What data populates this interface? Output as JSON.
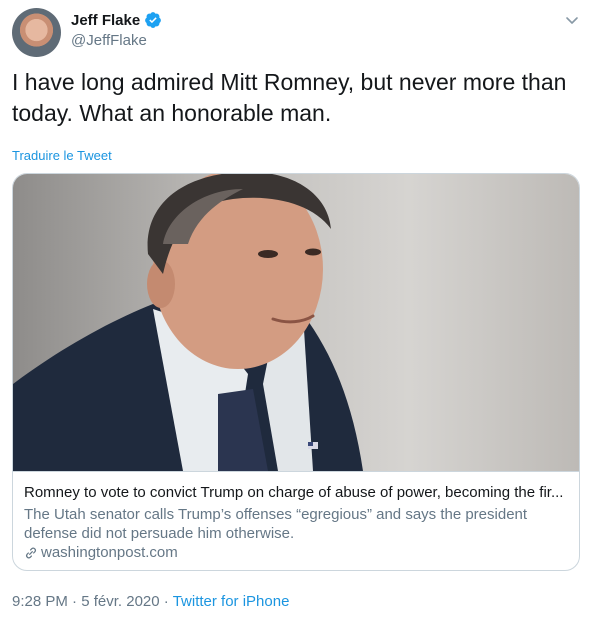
{
  "author": {
    "name": "Jeff Flake",
    "handle": "@JeffFlake"
  },
  "tweet": {
    "text": "I have long admired Mitt Romney, but never more than today. What an honorable man.",
    "translate_label": "Traduire le Tweet"
  },
  "card": {
    "title": "Romney to vote to convict Trump on charge of abuse of power, becoming the fir...",
    "description": "The Utah senator calls Trump’s offenses “egregious” and says the president defense did not persuade him otherwise.",
    "domain": "washingtonpost.com"
  },
  "meta": {
    "time": "9:28 PM",
    "separator": " · ",
    "date": "5 févr. 2020",
    "source": "Twitter for iPhone"
  },
  "colors": {
    "link": "#1b95e0",
    "secondary_text": "#657786",
    "border": "#ccd6dd",
    "verified": "#1da1f2"
  },
  "icons": {
    "verified": "verified-badge-icon",
    "chevron": "chevron-down-icon",
    "link": "link-icon"
  }
}
